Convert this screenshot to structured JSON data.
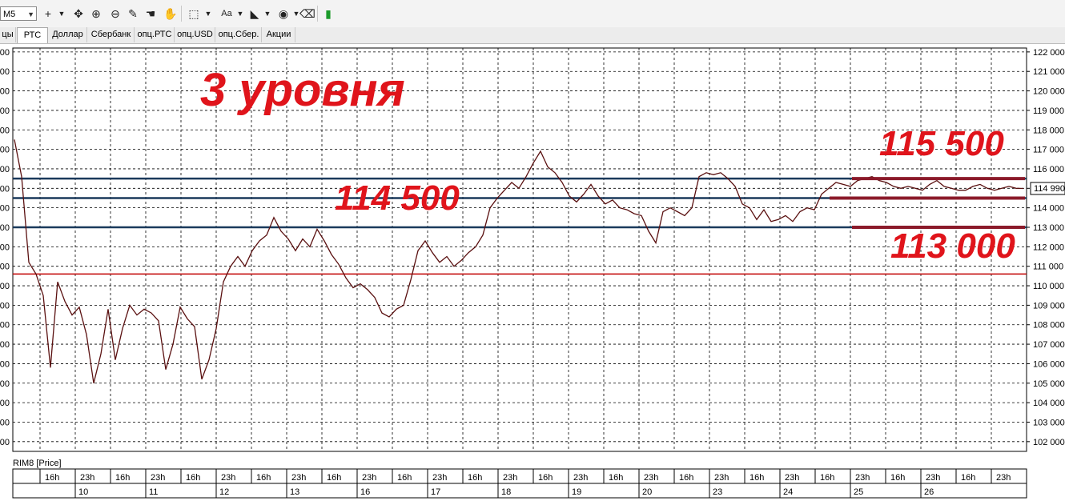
{
  "toolbar": {
    "timeframe": "M5",
    "text_tool": "Aa",
    "icons": [
      "crosshair-icon",
      "move-icon",
      "zoom-in-icon",
      "zoom-out-icon",
      "ruler-icon",
      "hand-icon",
      "select-icon",
      "rectangle-icon",
      "text-icon",
      "fill-icon",
      "eye-icon",
      "eraser-icon",
      "indicator-icon"
    ]
  },
  "tabs": [
    "цы",
    "РТС",
    "Доллар",
    "Сбербанк",
    "опц.РТС",
    "опц.USD",
    "опц.Сбер.",
    "Акции"
  ],
  "active_tab": "РТС",
  "instrument_label": "RIM8 [Price]",
  "price_marker": "114 990",
  "annotations": {
    "title": "3 уровня",
    "level_top": "115 500",
    "level_mid": "114 500",
    "level_bottom": "113 000"
  },
  "colors": {
    "candles": "#5a1010",
    "level_lines": "#1b3a5c",
    "support_line": "#c00000",
    "annotation": "#e0141b",
    "zone_lines": "#8b1a2a"
  },
  "chart_data": {
    "type": "line",
    "series": [
      {
        "x": [
          0,
          2,
          4,
          6,
          8,
          10,
          12,
          14,
          16,
          18,
          20,
          22,
          24,
          26,
          28,
          30,
          32,
          34,
          36,
          38,
          40,
          42,
          44,
          46,
          48,
          50,
          52,
          54,
          56,
          58,
          60,
          62,
          64,
          66,
          68,
          70,
          72,
          74,
          76,
          78,
          80,
          82,
          84,
          86,
          88,
          90,
          92,
          94,
          96,
          98,
          100,
          102,
          104,
          106,
          108,
          110,
          112,
          114,
          116,
          118,
          120,
          122,
          124,
          126,
          128,
          130,
          132,
          134,
          136,
          138,
          140,
          142,
          144,
          146,
          148,
          150,
          152,
          154,
          156,
          158,
          160,
          162,
          164,
          166,
          168,
          170,
          172,
          174,
          176,
          178,
          180,
          182,
          184,
          186,
          188,
          190,
          192,
          194,
          196,
          198,
          200,
          202,
          204,
          206,
          208,
          210,
          212,
          214,
          216,
          218,
          220,
          222,
          224,
          226,
          228,
          230,
          232,
          234,
          236,
          238,
          240,
          242,
          244,
          246,
          248,
          250,
          252,
          254,
          256,
          258,
          260,
          262,
          264,
          266,
          268,
          270,
          272,
          274,
          276,
          278,
          280
        ],
        "y": [
          117.5,
          115.6,
          111.2,
          110.6,
          109.5,
          105.8,
          110.2,
          109.2,
          108.5,
          108.9,
          107.5,
          105.0,
          106.5,
          108.8,
          106.2,
          107.8,
          109.0,
          108.5,
          108.8,
          108.6,
          108.2,
          105.7,
          107.0,
          108.9,
          108.3,
          107.9,
          105.2,
          106.2,
          107.8,
          110.2,
          111.0,
          111.5,
          111.0,
          111.8,
          112.3,
          112.6,
          113.5,
          112.8,
          112.4,
          111.8,
          112.4,
          112.0,
          112.9,
          112.3,
          111.6,
          111.1,
          110.4,
          109.9,
          110.1,
          109.8,
          109.4,
          108.6,
          108.4,
          108.8,
          109.0,
          110.3,
          111.8,
          112.3,
          111.7,
          111.2,
          111.5,
          111.0,
          111.3,
          111.7,
          112.0,
          112.6,
          114.0,
          114.5,
          114.9,
          115.3,
          115.0,
          115.6,
          116.3,
          116.9,
          116.1,
          115.8,
          115.3,
          114.6,
          114.3,
          114.7,
          115.2,
          114.6,
          114.2,
          114.4,
          114.0,
          113.9,
          113.7,
          113.6,
          112.8,
          112.2,
          113.8,
          114.0,
          113.8,
          113.6,
          114.0,
          115.6,
          115.8,
          115.7,
          115.8,
          115.5,
          115.1,
          114.2,
          114.0,
          113.4,
          113.9,
          113.3,
          113.4,
          113.6,
          113.3,
          113.8,
          114.0,
          113.9,
          114.7,
          115.0,
          115.3,
          115.2,
          115.1,
          115.4,
          115.5,
          115.6,
          115.4,
          115.3,
          115.1,
          115.0,
          115.1,
          115.0,
          114.9,
          115.2,
          115.4,
          115.1,
          115.0,
          114.9,
          114.9,
          115.1,
          115.2,
          115.0,
          114.9,
          115.0,
          115.1,
          115.0,
          114.99
        ]
      }
    ],
    "y_ticks": [
      "122 000",
      "121 000",
      "120 000",
      "119 000",
      "118 000",
      "117 000",
      "116 000",
      "115 000",
      "114 000",
      "113 000",
      "112 000",
      "111 000",
      "110 000",
      "109 000",
      "108 000",
      "107 000",
      "106 000",
      "105 000",
      "104 000",
      "103 000",
      "102 000"
    ],
    "x_ticks_time": [
      "16h",
      "23h",
      "16h",
      "23h",
      "16h",
      "23h",
      "16h",
      "23h",
      "16h",
      "23h",
      "16h",
      "23h",
      "16h",
      "23h",
      "16h",
      "23h",
      "16h",
      "23h",
      "16h",
      "23h",
      "16h",
      "23h",
      "16h",
      "23h",
      "16h",
      "23h",
      "16h",
      "23h"
    ],
    "x_ticks_day": [
      "10",
      "11",
      "12",
      "13",
      "16",
      "17",
      "18",
      "19",
      "20",
      "23",
      "24",
      "25",
      "26"
    ],
    "ylim": [
      101.5,
      122.2
    ],
    "grid": true
  }
}
